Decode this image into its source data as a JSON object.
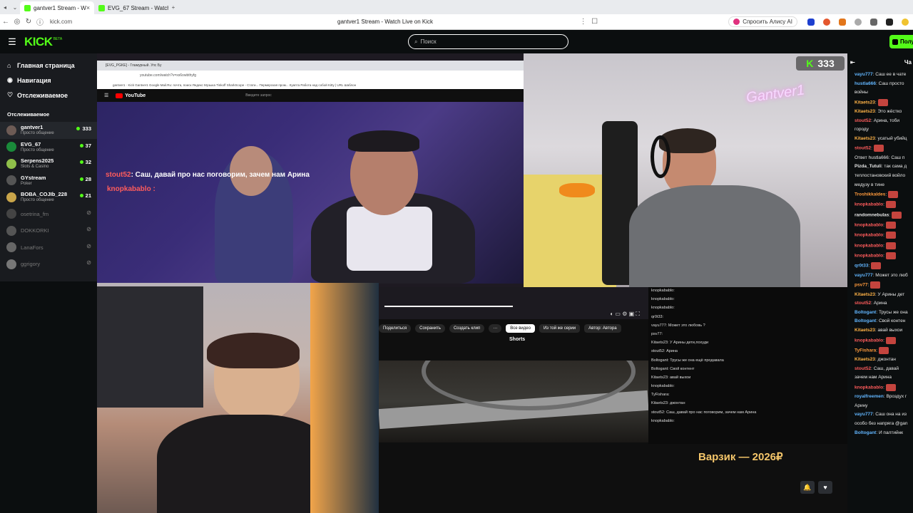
{
  "browser": {
    "tabs": [
      {
        "label": "gantver1 Stream - W",
        "active": true
      },
      {
        "label": "EVG_67 Stream - Watch Li",
        "active": false
      }
    ],
    "url": "kick.com",
    "page_title": "gantver1 Stream - Watch Live on Kick",
    "alisa_label": "Спросить Алису AI"
  },
  "header": {
    "logo": "KICK",
    "logo_badge": "BETA",
    "search_placeholder": "Поиск",
    "login_label": "Полу"
  },
  "sidebar": {
    "nav": [
      {
        "label": "Главная страница",
        "icon": "home-icon"
      },
      {
        "label": "Навигация",
        "icon": "compass-icon"
      },
      {
        "label": "Отслеживаемое",
        "icon": "heart-icon"
      }
    ],
    "following_title": "Отслеживаемое",
    "channels": [
      {
        "name": "gantver1",
        "category": "Просто общение",
        "viewers": "333",
        "live": true,
        "color": "#6d5b55"
      },
      {
        "name": "EVG_67",
        "category": "Просто общение",
        "viewers": "37",
        "live": true,
        "color": "#1a8a3a"
      },
      {
        "name": "Serpens2025",
        "category": "Slots & Casino",
        "viewers": "32",
        "live": true,
        "color": "#8fbf4a"
      },
      {
        "name": "GYstream",
        "category": "Poker",
        "viewers": "28",
        "live": true,
        "color": "#555555"
      },
      {
        "name": "BOBA_COJIb_228",
        "category": "Просто общение",
        "viewers": "21",
        "live": true,
        "color": "#c9a54a"
      },
      {
        "name": "osetrina_fm",
        "category": "",
        "viewers": "",
        "live": false,
        "color": "#444"
      },
      {
        "name": "DOKKORKI",
        "category": "",
        "viewers": "",
        "live": false,
        "color": "#555"
      },
      {
        "name": "LanaFors",
        "category": "",
        "viewers": "",
        "live": false,
        "color": "#666"
      },
      {
        "name": "ggrigory",
        "category": "",
        "viewers": "",
        "live": false,
        "color": "#777"
      }
    ]
  },
  "player": {
    "youtube_url": "youtube.com/watch?v=xs6owbthyfg",
    "youtube_tab": "[EVG_PGKE] - Гламурный. Упс Бу",
    "youtube_logo": "YouTube",
    "youtube_search_placeholder": "Введите запрос",
    "bookmarks": "gantver1 · Kick   Gantver1   Google   Mail.Ru: почта, поиск   Яндекс Музыка   Tinkoff   SharkScope - Стати...   Пермерская пром...   Куапта   Работа над собой   Kitty | URL Шаблон",
    "overlay_line1_user": "stout52",
    "overlay_line1_text": ": Саш, давай про нас поговорим, зачем нам Арина",
    "overlay_line2_user": "knopkabablo",
    "viewer_count": "333",
    "neon_sign": "Gantver1",
    "yt_buttons": [
      "Поделиться",
      "Сохранить",
      "Создать клип",
      "···"
    ],
    "yt_pills": [
      "Все видео",
      "Из той же серии",
      "Автор: Автора"
    ],
    "shorts_label": "Shorts",
    "donate_text": "Варзик — 2026₽",
    "mini_chat": [
      "knopkabablo:",
      "knopkabablo:",
      "knopkabablo:",
      "qr0t33:",
      "vayu777: Может это любовь ?",
      "psv77:",
      "Kitaets23: У Арины дети,похуди",
      "stout52: Арина",
      "Boltogant: Трусы же она ещё продавала",
      "Boltogant: Свой контент",
      "Kitaets23: авай выхои",
      "knopkabablo:",
      "TyFishara:",
      "Kitaets23: джонтан",
      "stout52: Саш, давай про нас поговорим, зачем нам Арина",
      "knopkabablo:"
    ]
  },
  "chat": {
    "title": "Ча",
    "messages": [
      {
        "user": "vayu777",
        "text": ": Саш ее в чате",
        "color": "#62b6ff"
      },
      {
        "user": "hustla666",
        "text": ": Саш просто",
        "color": "#62b6ff"
      },
      {
        "user": "",
        "text": "войны",
        "color": "#e6e6e6"
      },
      {
        "user": "Kitaets23",
        "text": ":",
        "color": "#ffb347"
      },
      {
        "user": "Kitaets23",
        "text": ": Это жёстко",
        "color": "#ffb347"
      },
      {
        "user": "stout52",
        "text": ": Арина, тоби",
        "color": "#ff5c5c"
      },
      {
        "user": "",
        "text": "городу",
        "color": "#e6e6e6"
      },
      {
        "user": "Kitaets23",
        "text": ": усатый убийц",
        "color": "#ffb347"
      },
      {
        "user": "stout52",
        "text": ":",
        "color": "#ff5c5c"
      },
      {
        "user": "",
        "text": "Ответ hustla666: Саш п",
        "color": "#888888"
      },
      {
        "user": "Pizda_Tutuli",
        "text": ": так сама д",
        "color": "#e6e6e6"
      },
      {
        "user": "",
        "text": "теплостановский войло",
        "color": "#e6e6e6"
      },
      {
        "user": "",
        "text": "медузу в тине",
        "color": "#e6e6e6"
      },
      {
        "user": "Troshikkaldes",
        "text": ":",
        "color": "#ff9a3c"
      },
      {
        "user": "knopkabablo",
        "text": ":",
        "color": "#ff5c5c"
      },
      {
        "user": "randomnebulas",
        "text": ":",
        "color": "#e6e6e6"
      },
      {
        "user": "knopkabablo",
        "text": ":",
        "color": "#ff5c5c"
      },
      {
        "user": "knopkabablo",
        "text": ":",
        "color": "#ff5c5c"
      },
      {
        "user": "knopkabablo",
        "text": ":",
        "color": "#ff5c5c"
      },
      {
        "user": "knopkabablo",
        "text": ":",
        "color": "#ff5c5c"
      },
      {
        "user": "qr0t33",
        "text": ":",
        "color": "#62b6ff"
      },
      {
        "user": "vayu777",
        "text": ": Может это люб",
        "color": "#62b6ff"
      },
      {
        "user": "psv77",
        "text": ":",
        "color": "#ff9a3c"
      },
      {
        "user": "Kitaets23",
        "text": ": У Арины дет",
        "color": "#ffb347"
      },
      {
        "user": "stout52",
        "text": ": Арина",
        "color": "#ff5c5c"
      },
      {
        "user": "Boltogant",
        "text": ": Трусы же она",
        "color": "#62b6ff"
      },
      {
        "user": "Boltogant",
        "text": ": Свой контен",
        "color": "#62b6ff"
      },
      {
        "user": "Kitaets23",
        "text": ": авай выхои",
        "color": "#ffb347"
      },
      {
        "user": "knopkabablo",
        "text": ":",
        "color": "#ff5c5c"
      },
      {
        "user": "TyFishara",
        "text": ":",
        "color": "#ff9a3c"
      },
      {
        "user": "Kitaets23",
        "text": ": джонтан",
        "color": "#ffb347"
      },
      {
        "user": "stout52",
        "text": ": Саш, давай",
        "color": "#ff5c5c"
      },
      {
        "user": "",
        "text": "зачем нам Арина",
        "color": "#e6e6e6"
      },
      {
        "user": "knopkabablo",
        "text": ":",
        "color": "#ff5c5c"
      },
      {
        "user": "royalfreemen",
        "text": ": Вроздух г",
        "color": "#62b6ff"
      },
      {
        "user": "",
        "text": "Арину",
        "color": "#e6e6e6"
      },
      {
        "user": "vayu777",
        "text": ": Саш она на из",
        "color": "#62b6ff"
      },
      {
        "user": "",
        "text": "особо без напряга @gan",
        "color": "#e6e6e6"
      },
      {
        "user": "Boltogant",
        "text": ": И палтийнк",
        "color": "#62b6ff"
      }
    ]
  },
  "colors": {
    "accent": "#53fc18",
    "background": "#0b0e0f",
    "sidebar": "#191b1f"
  }
}
